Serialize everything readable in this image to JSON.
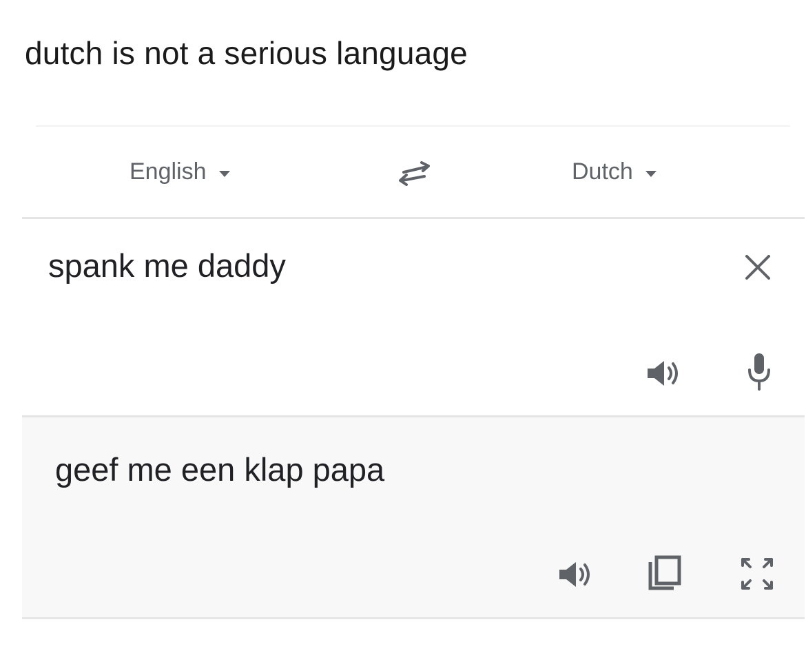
{
  "caption": "dutch is not a serious language",
  "languages": {
    "source": "English",
    "target": "Dutch"
  },
  "input": {
    "value": "spank me daddy"
  },
  "output": {
    "value": "geef me een klap papa"
  },
  "icons": [
    "dropdown-caret-icon",
    "swap-languages-icon",
    "close-icon",
    "speaker-icon",
    "microphone-icon",
    "copy-icon",
    "fullscreen-icon"
  ],
  "colors": {
    "text": "#202124",
    "muted": "#5f6368",
    "output_background": "#f8f8f9",
    "divider": "#e4e4e4"
  }
}
